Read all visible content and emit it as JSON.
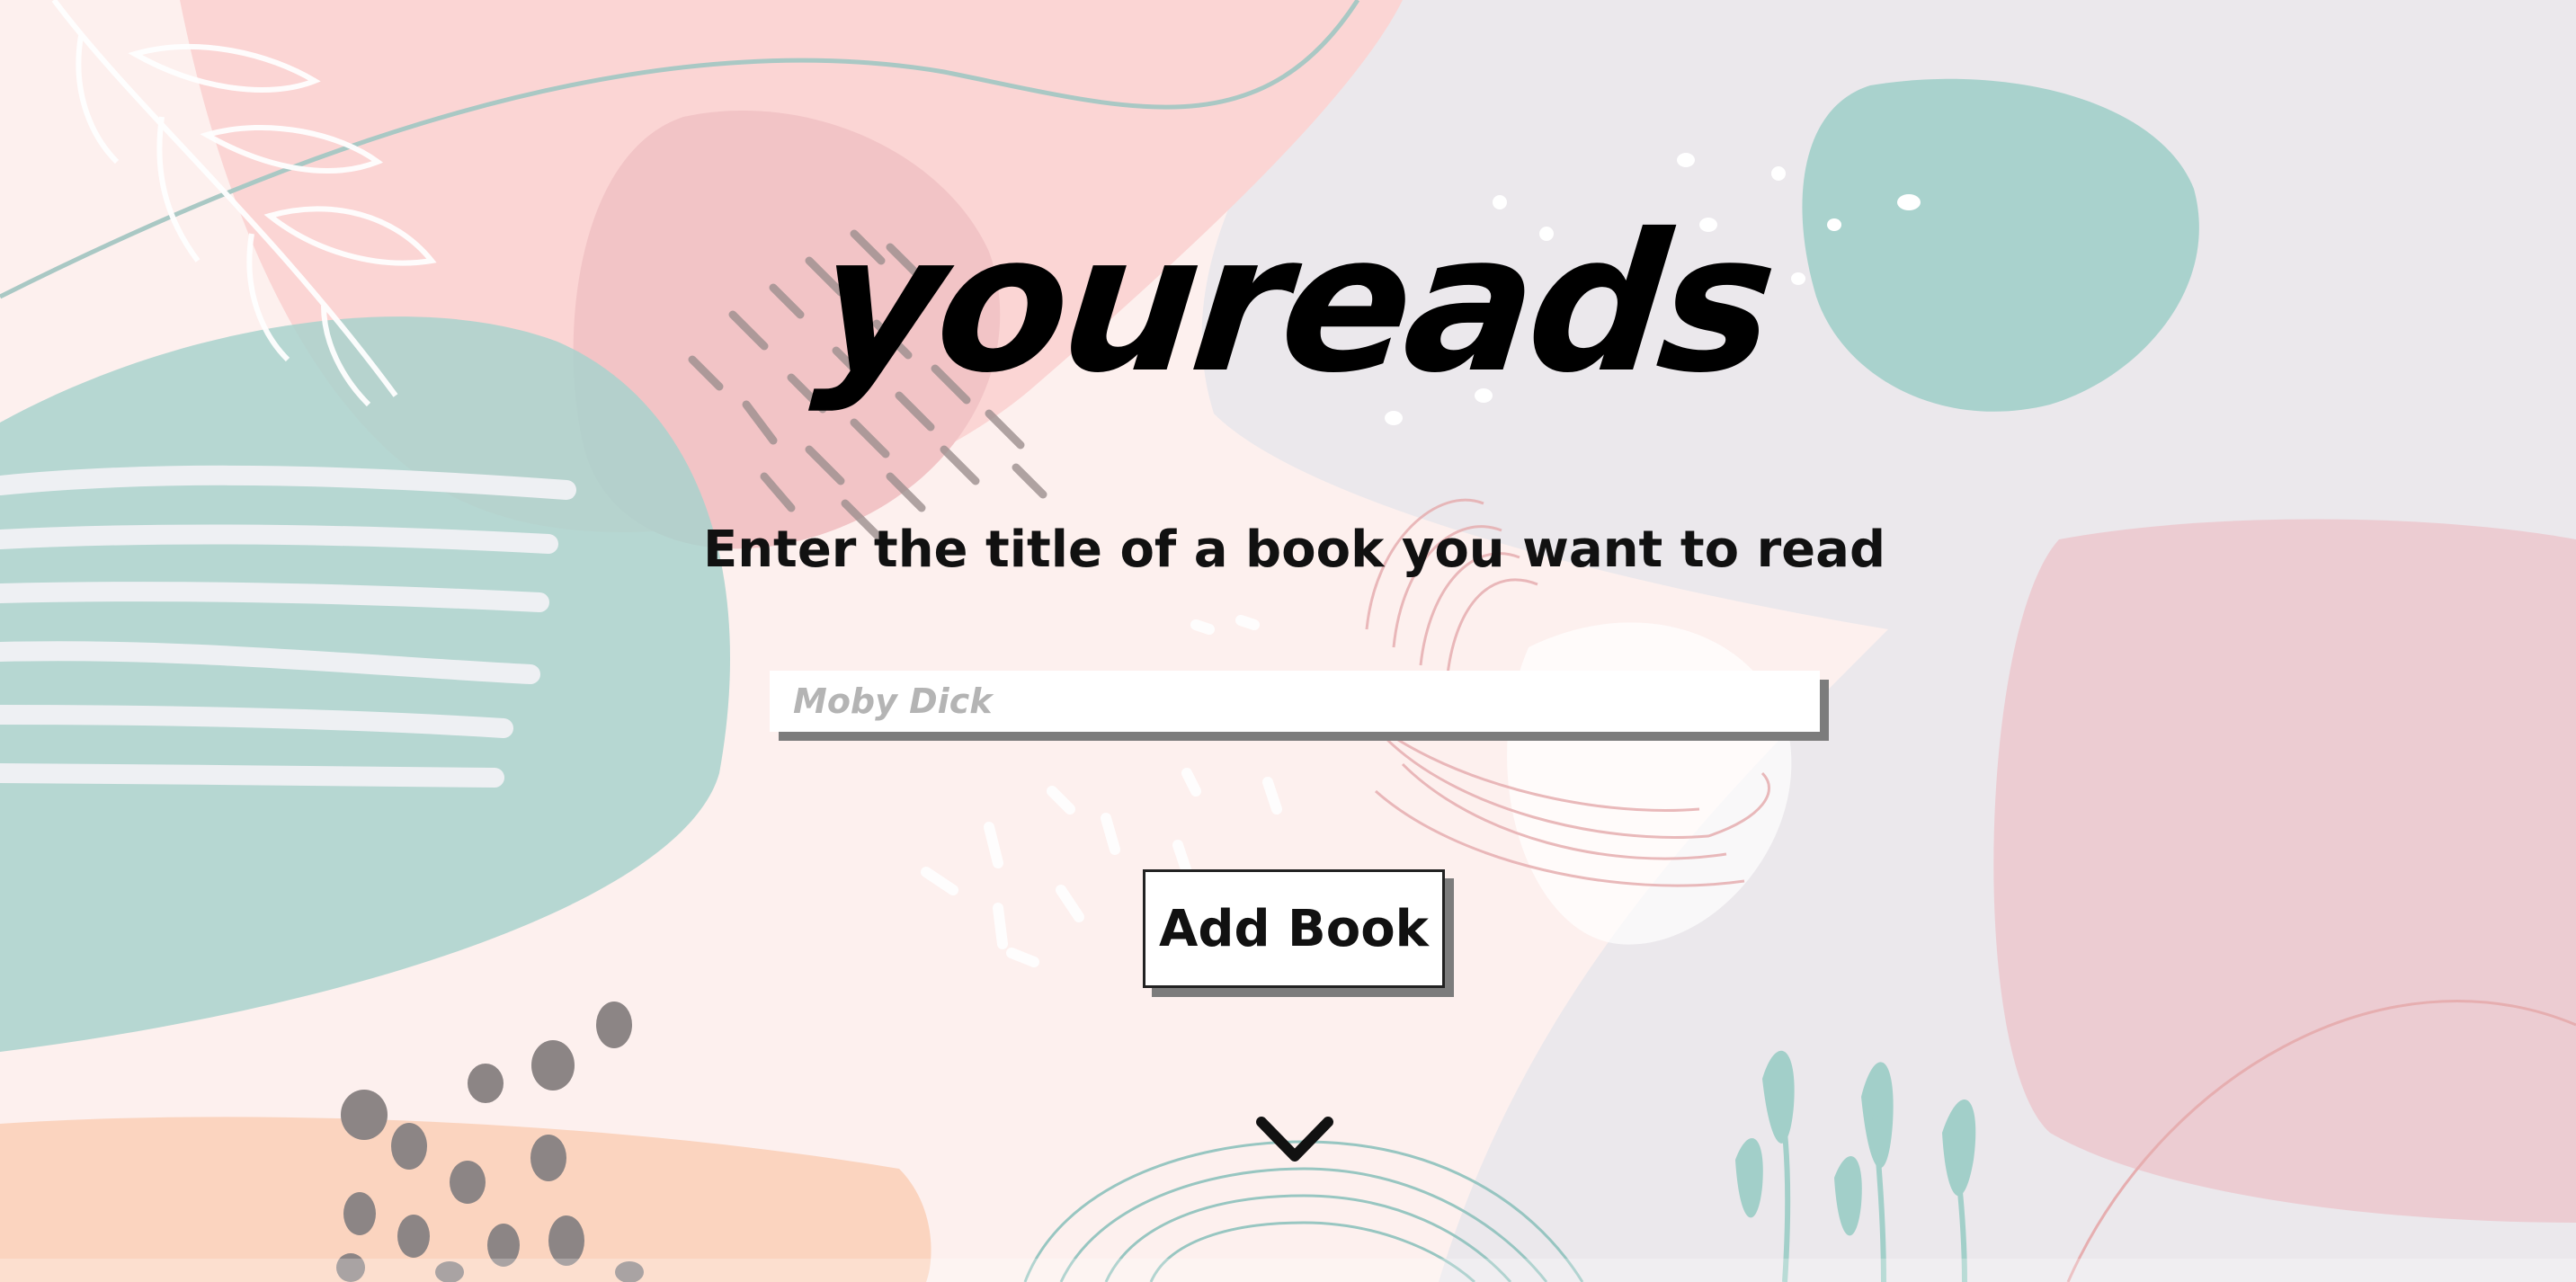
{
  "app": {
    "logo_text": "youreads"
  },
  "form": {
    "prompt": "Enter the title of a book you want to read",
    "title_input": {
      "value": "",
      "placeholder": "Moby Dick"
    },
    "add_button_label": "Add Book"
  },
  "icons": {
    "scroll_down": "chevron-down-icon"
  },
  "colors": {
    "background_pink": "#fbd5d4",
    "background_teal": "#a9d2cd",
    "background_gray": "#ebe8ec",
    "background_peach": "#fbd4bf",
    "text": "#000000",
    "placeholder": "#b4b4b4",
    "shadow": "#7c7c7c"
  }
}
